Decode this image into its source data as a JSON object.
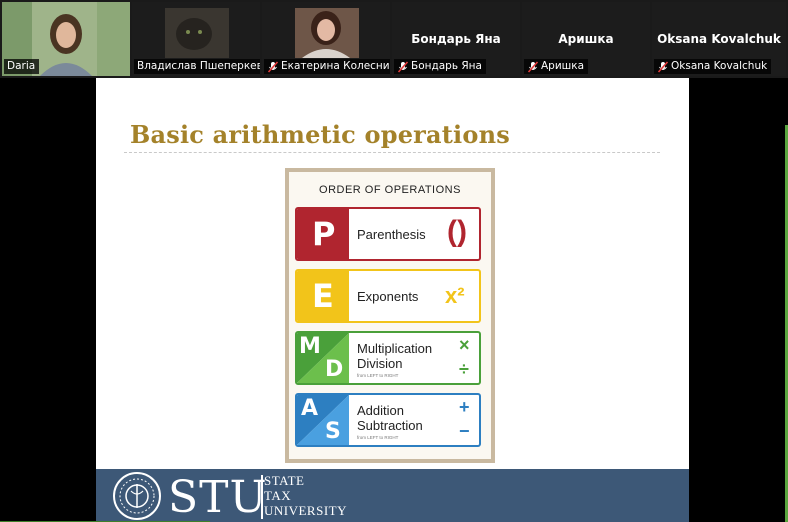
{
  "participants": [
    {
      "name": "Daria",
      "muted": false,
      "active": true,
      "has_video": true
    },
    {
      "name": "Владислав Пшеперкеви...",
      "muted": false,
      "active": false,
      "has_video": true
    },
    {
      "name": "Екатерина Колесник",
      "muted": true,
      "active": false,
      "has_video": true
    },
    {
      "name": "Бондарь Яна",
      "muted": true,
      "active": false,
      "has_video": false,
      "display_name": "Бондарь Яна"
    },
    {
      "name": "Аришка",
      "muted": true,
      "active": false,
      "has_video": false,
      "display_name": "Аришка"
    },
    {
      "name": "Oksana Kovalchuk",
      "muted": true,
      "active": false,
      "has_video": false,
      "display_name": "Oksana Kovalchuk"
    }
  ],
  "slide": {
    "title": "Basic arithmetic operations",
    "poster": {
      "heading": "ORDER OF OPERATIONS",
      "rows": [
        {
          "letters": [
            "P"
          ],
          "label": "Parenthesis",
          "symbol": "()",
          "color": "#b0252f"
        },
        {
          "letters": [
            "E"
          ],
          "label": "Exponents",
          "symbol": "x²",
          "color": "#f2c41a"
        },
        {
          "letters": [
            "M",
            "D"
          ],
          "label": "Multiplication\nDivision",
          "sub": "from LEFT to RIGHT",
          "symbols": [
            "×",
            "÷"
          ],
          "color": "#4aa03a"
        },
        {
          "letters": [
            "A",
            "S"
          ],
          "label": "Addition\nSubtraction",
          "sub": "from LEFT to RIGHT",
          "symbols": [
            "+",
            "−"
          ],
          "color": "#2d7fc1"
        }
      ]
    },
    "footer": {
      "logo": "STU",
      "lines": [
        "STATE",
        "TAX",
        "UNIVERSITY"
      ]
    }
  },
  "colors": {
    "title": "#a4822a",
    "footer": "#3d5877",
    "active_border": "#23d959"
  }
}
